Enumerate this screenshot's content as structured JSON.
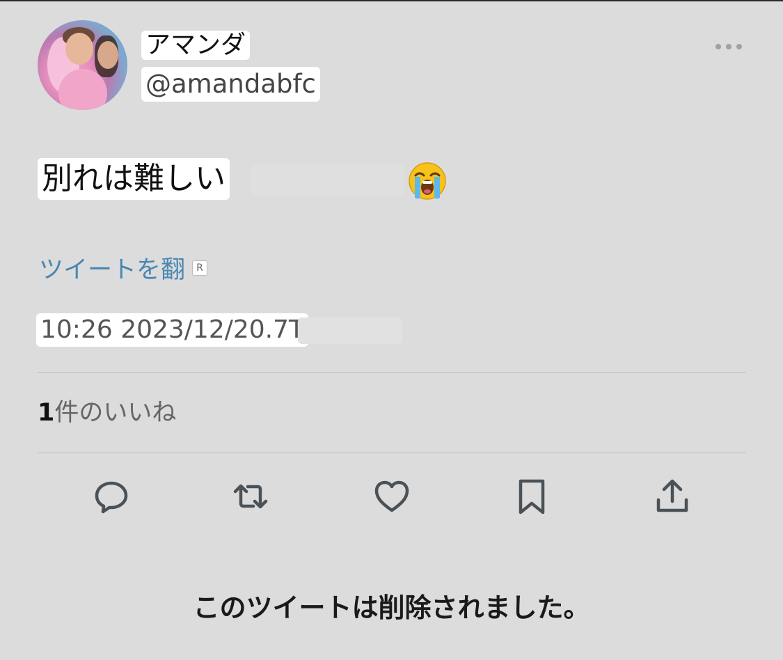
{
  "user": {
    "display_name": "アマンダ",
    "handle": "@amandabfc"
  },
  "tweet": {
    "text": "別れは難しい",
    "emoji": "loudly-crying-face",
    "translate_label": "ツイートを翻",
    "translate_badge": "R",
    "timestamp": "10:26 2023/12/20.7T"
  },
  "stats": {
    "likes_count": "1",
    "likes_label": "件のいいね"
  },
  "actions": [
    "reply-icon",
    "retweet-icon",
    "like-icon",
    "bookmark-icon",
    "share-icon"
  ],
  "status_message": "このツイートは削除されました。",
  "colors": {
    "background": "#dcdcdc",
    "link_blue": "#4a87b3",
    "icon_gray": "#4a5258",
    "highlight": "#ffffff"
  }
}
